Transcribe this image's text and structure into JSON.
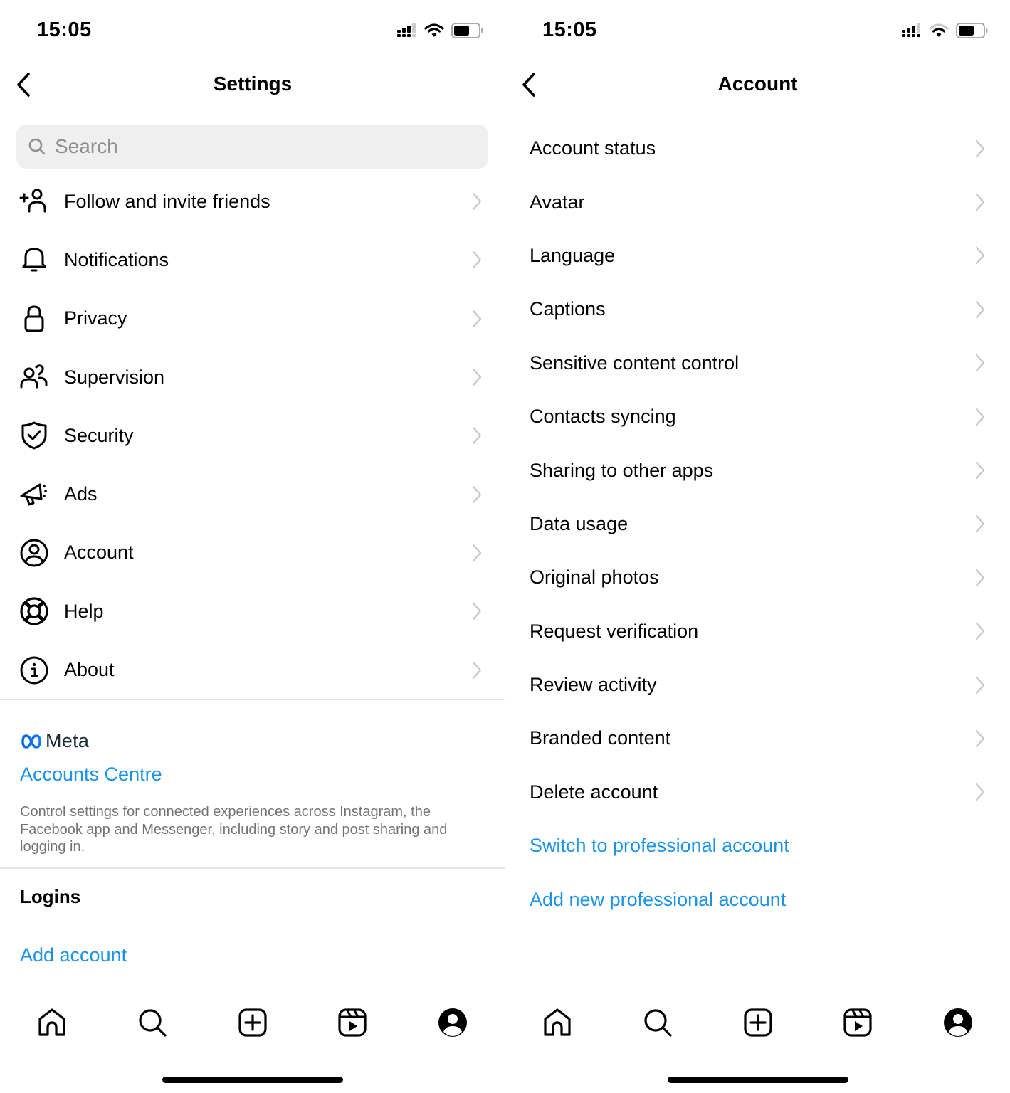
{
  "status_bar": {
    "time": "15:05"
  },
  "settings_screen": {
    "title": "Settings",
    "search": {
      "placeholder": "Search",
      "value": ""
    },
    "items": [
      {
        "label": "Follow and invite friends",
        "icon": "add-person-icon"
      },
      {
        "label": "Notifications",
        "icon": "bell-icon"
      },
      {
        "label": "Privacy",
        "icon": "lock-icon"
      },
      {
        "label": "Supervision",
        "icon": "people-icon"
      },
      {
        "label": "Security",
        "icon": "shield-check-icon"
      },
      {
        "label": "Ads",
        "icon": "megaphone-icon"
      },
      {
        "label": "Account",
        "icon": "account-circle-icon"
      },
      {
        "label": "Help",
        "icon": "lifebuoy-icon"
      },
      {
        "label": "About",
        "icon": "info-icon"
      }
    ],
    "meta": {
      "brand": "Meta",
      "accounts_centre": "Accounts Centre",
      "description": "Control settings for connected experiences across Instagram, the Facebook app and Messenger, including story and post sharing and logging in."
    },
    "logins": {
      "heading": "Logins",
      "add_account": "Add account"
    }
  },
  "account_screen": {
    "title": "Account",
    "items": [
      {
        "label": "Account status"
      },
      {
        "label": "Avatar"
      },
      {
        "label": "Language"
      },
      {
        "label": "Captions"
      },
      {
        "label": "Sensitive content control"
      },
      {
        "label": "Contacts syncing"
      },
      {
        "label": "Sharing to other apps"
      },
      {
        "label": "Data usage"
      },
      {
        "label": "Original photos"
      },
      {
        "label": "Request verification"
      },
      {
        "label": "Review activity"
      },
      {
        "label": "Branded content"
      },
      {
        "label": "Delete account"
      }
    ],
    "links": [
      {
        "label": "Switch to professional account"
      },
      {
        "label": "Add new professional account"
      }
    ]
  },
  "tab_bar": {
    "tabs": [
      {
        "name": "home",
        "icon": "home-icon"
      },
      {
        "name": "search",
        "icon": "search-icon"
      },
      {
        "name": "create",
        "icon": "create-post-icon"
      },
      {
        "name": "reels",
        "icon": "reels-icon"
      },
      {
        "name": "profile",
        "icon": "profile-icon"
      }
    ]
  },
  "colors": {
    "link_blue": "#1d93e6",
    "meta_blue": "#0668e1",
    "secondary_text": "#737373",
    "chevron_grey": "#c7c7cc",
    "search_bg": "#efefef"
  }
}
